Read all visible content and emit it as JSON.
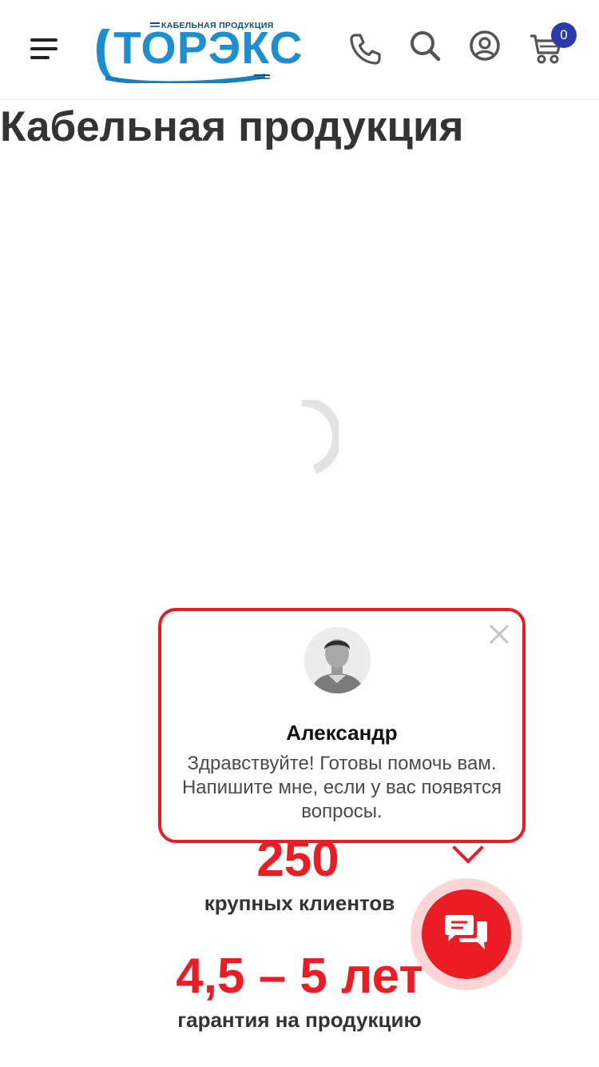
{
  "header": {
    "logo_sub": "КАБЕЛЬНАЯ ПРОДУКЦИЯ",
    "logo_main": "ТОРЭКС",
    "cart_count": "0",
    "icons": [
      "menu-icon",
      "phone-icon",
      "search-icon",
      "user-icon",
      "cart-icon"
    ]
  },
  "page": {
    "title": "Кабельная продукция"
  },
  "stats": [
    {
      "number": "250",
      "label": "крупных клиентов"
    },
    {
      "number": "4,5 – 5 лет",
      "label": "гарантия на продукцию"
    }
  ],
  "chat": {
    "agent_name": "Александр",
    "message": "Здравствуйте! Готовы помочь вам. Напишите мне, если у вас появятся вопросы."
  },
  "colors": {
    "accent": "#ec1c24",
    "badge": "#2d3ba8",
    "logo_blue": "#1d8fd0",
    "text": "#333333"
  }
}
